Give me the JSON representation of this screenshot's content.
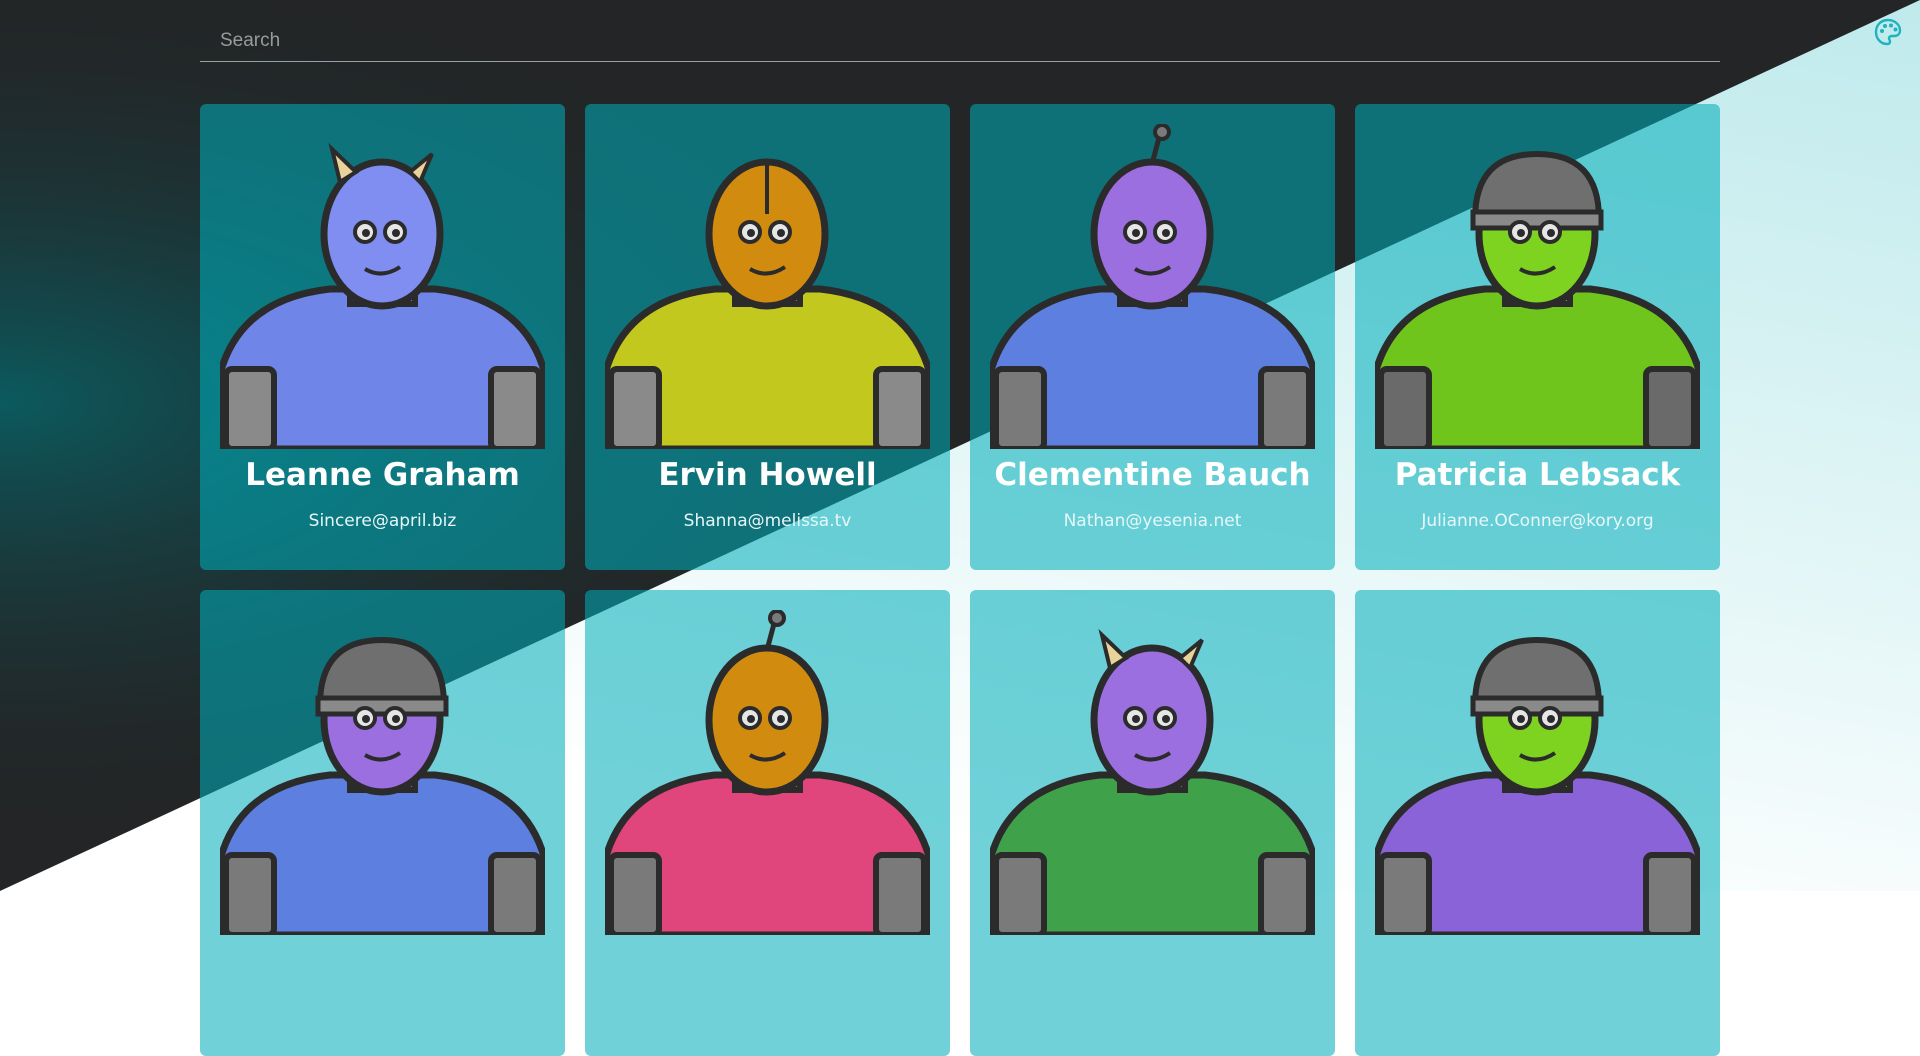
{
  "search": {
    "placeholder": "Search",
    "value": ""
  },
  "theme_toggle": {
    "icon": "palette-icon"
  },
  "colors": {
    "background_dark": "#232526",
    "background_light": "#ffffff",
    "card": "#00adb9",
    "text": "#ffffff",
    "accent_icon": "#1fb3bf"
  },
  "users": [
    {
      "name": "Leanne Graham",
      "email": "Sincere@april.biz",
      "avatar": {
        "skin": "#7f8ef0",
        "shirt": "#6f86e8",
        "head": "horned",
        "gear": "#8a8a8a"
      }
    },
    {
      "name": "Ervin Howell",
      "email": "Shanna@melissa.tv",
      "avatar": {
        "skin": "#d18c0f",
        "shirt": "#c3c81f",
        "head": "mask",
        "gear": "#8a8a8a"
      }
    },
    {
      "name": "Clementine Bauch",
      "email": "Nathan@yesenia.net",
      "avatar": {
        "skin": "#9b6fe0",
        "shirt": "#5d7fe0",
        "head": "antenna",
        "gear": "#7a7a7a"
      }
    },
    {
      "name": "Patricia Lebsack",
      "email": "Julianne.OConner@kory.org",
      "avatar": {
        "skin": "#7ed321",
        "shirt": "#70c51d",
        "head": "helmet",
        "gear": "#6a6a6a"
      }
    },
    {
      "name": "",
      "email": "",
      "avatar": {
        "skin": "#9b6fe0",
        "shirt": "#5d7fe0",
        "head": "helmet",
        "gear": "#7a7a7a"
      }
    },
    {
      "name": "",
      "email": "",
      "avatar": {
        "skin": "#d18c0f",
        "shirt": "#e0457b",
        "head": "antenna",
        "gear": "#7a7a7a"
      }
    },
    {
      "name": "",
      "email": "",
      "avatar": {
        "skin": "#9b6fe0",
        "shirt": "#3fa24b",
        "head": "horned",
        "gear": "#7a7a7a"
      }
    },
    {
      "name": "",
      "email": "",
      "avatar": {
        "skin": "#7ed321",
        "shirt": "#8a63d8",
        "head": "helmet",
        "gear": "#7a7a7a"
      }
    }
  ]
}
